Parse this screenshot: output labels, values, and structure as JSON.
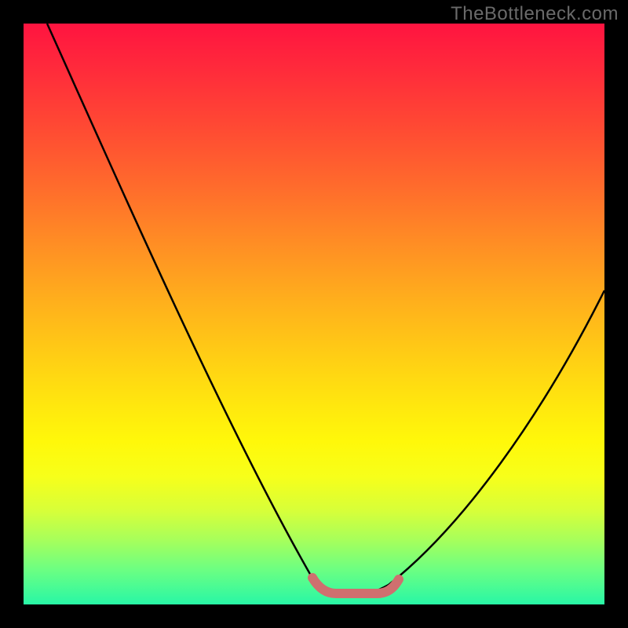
{
  "watermark": "TheBottleneck.com",
  "colors": {
    "frame": "#000000",
    "curve": "#000000",
    "highlight": "#cf6f6f",
    "gradient_stops": [
      "#ff1440",
      "#ff2b3b",
      "#ff4a33",
      "#ff6b2c",
      "#ff8e24",
      "#ffb01c",
      "#ffd014",
      "#ffe80e",
      "#fff80a",
      "#f7ff1a",
      "#d6ff3a",
      "#a6ff5c",
      "#6cff82",
      "#28f7a6"
    ]
  },
  "chart_data": {
    "type": "line",
    "title": "",
    "xlabel": "",
    "ylabel": "",
    "xlim": [
      0,
      100
    ],
    "ylim": [
      0,
      100
    ],
    "grid": false,
    "legend": false,
    "series": [
      {
        "name": "bottleneck-curve",
        "x": [
          4,
          10,
          16,
          22,
          28,
          34,
          40,
          46,
          52,
          56,
          60,
          64,
          70,
          76,
          82,
          88,
          94,
          100
        ],
        "values": [
          100,
          88,
          76,
          64,
          52,
          40,
          28,
          16,
          6,
          2,
          2,
          6,
          14,
          22,
          30,
          38,
          46,
          54
        ]
      }
    ],
    "highlight_band": {
      "x_start": 50,
      "x_end": 66,
      "y": 2
    }
  }
}
